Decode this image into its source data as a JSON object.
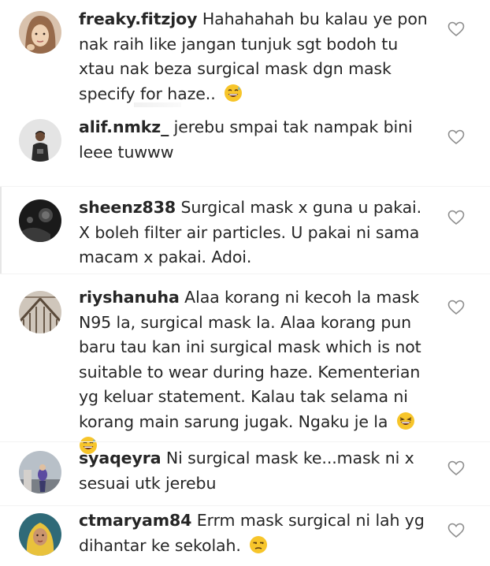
{
  "comments": [
    {
      "username": "freaky.fitzjoy",
      "lines": [
        "Hahahahah bu kalau ye pon",
        "nak raih like jangan tunjuk sgt bodoh tu",
        "xtau nak beza surgical mask dgn mask",
        "specify for haze.."
      ],
      "emoji": "grinning-sweat-face",
      "avatar_icon": "user-avatar-woman"
    },
    {
      "username": "alif.nmkz_",
      "lines": [
        "jerebu smpai tak nampak bini",
        "leee tuwww"
      ],
      "avatar_icon": "user-avatar-man"
    },
    {
      "username": "sheenz838",
      "lines": [
        "Surgical mask x guna u pakai.",
        "X boleh filter air particles. U pakai ni sama",
        "macam x pakai. Adoi."
      ],
      "avatar_icon": "user-avatar-dark"
    },
    {
      "username": "riyshanuha",
      "lines": [
        "Alaa korang ni kecoh la mask",
        "N95 la, surgical mask la. Alaa korang pun",
        "baru tau kan ini surgical mask which is not",
        "suitable to wear during haze. Kementerian",
        "yg keluar statement. Kalau tak selama ni",
        "korang main sarung jugak. Ngaku je la"
      ],
      "emoji": "laughing-face",
      "emoji2": "grinning-sweat-face",
      "avatar_icon": "user-avatar-building"
    },
    {
      "username": "syaqeyra",
      "lines": [
        "Ni surgical mask ke...mask ni x",
        "sesuai utk jerebu"
      ],
      "avatar_icon": "user-avatar-outdoor"
    },
    {
      "username": "ctmaryam84",
      "lines": [
        "Errm mask surgical ni lah yg",
        "dihantar ke sekolah."
      ],
      "emoji": "unamused-face",
      "avatar_icon": "user-avatar-hijab"
    }
  ],
  "colors": {
    "text": "#262626",
    "heart_stroke": "#8e8e8e",
    "emoji_yellow": "#f7c52a"
  },
  "icons": {
    "like": "heart-icon"
  }
}
